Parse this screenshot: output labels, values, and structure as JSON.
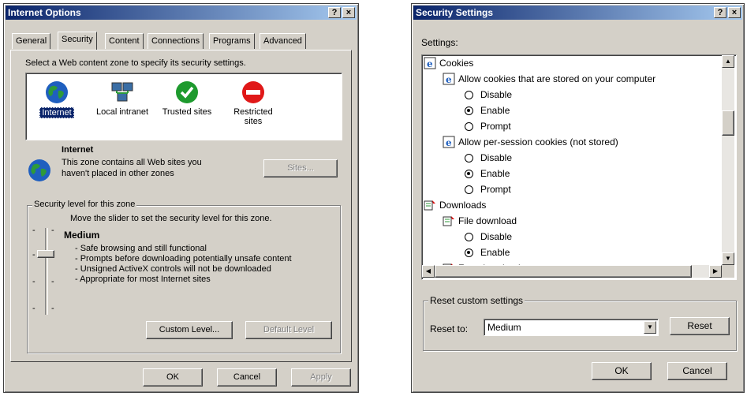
{
  "internet_options": {
    "title": "Internet Options",
    "help_label": "?",
    "close_label": "×",
    "tabs": [
      "General",
      "Security",
      "Content",
      "Connections",
      "Programs",
      "Advanced"
    ],
    "active_tab": "Security",
    "zone_prompt": "Select a Web content zone to specify its security settings.",
    "zones": [
      {
        "label": "Internet",
        "icon": "globe-icon"
      },
      {
        "label": "Local intranet",
        "icon": "intranet-icon"
      },
      {
        "label": "Trusted sites",
        "icon": "checkmark-icon"
      },
      {
        "label": "Restricted sites",
        "icon": "no-entry-icon"
      }
    ],
    "zone_title": "Internet",
    "zone_desc_1": "This zone contains all Web sites you",
    "zone_desc_2": "haven't placed in other zones",
    "sites_button": "Sites...",
    "security_group_label": "Security level for this zone",
    "slider_hint": "Move the slider to set the security level for this zone.",
    "level_name": "Medium",
    "level_bullets": [
      "- Safe browsing and still functional",
      "- Prompts before downloading potentially unsafe content",
      "- Unsigned ActiveX controls will not be downloaded",
      "- Appropriate for most Internet sites"
    ],
    "custom_level_button": "Custom Level...",
    "default_level_button": "Default Level",
    "ok_button": "OK",
    "cancel_button": "Cancel",
    "apply_button": "Apply"
  },
  "security_settings": {
    "title": "Security Settings",
    "help_label": "?",
    "close_label": "×",
    "settings_label": "Settings:",
    "tree": [
      {
        "text": "Cookies",
        "kind": "category"
      },
      {
        "text": "Allow cookies that are stored on your computer",
        "kind": "setting"
      },
      {
        "text": "Disable",
        "kind": "option",
        "selected": false
      },
      {
        "text": "Enable",
        "kind": "option",
        "selected": true
      },
      {
        "text": "Prompt",
        "kind": "option",
        "selected": false
      },
      {
        "text": "Allow per-session cookies (not stored)",
        "kind": "setting"
      },
      {
        "text": "Disable",
        "kind": "option",
        "selected": false
      },
      {
        "text": "Enable",
        "kind": "option",
        "selected": true
      },
      {
        "text": "Prompt",
        "kind": "option",
        "selected": false
      },
      {
        "text": "Downloads",
        "kind": "category"
      },
      {
        "text": "File download",
        "kind": "setting"
      },
      {
        "text": "Disable",
        "kind": "option",
        "selected": false
      },
      {
        "text": "Enable",
        "kind": "option",
        "selected": true
      },
      {
        "text": "Font download",
        "kind": "setting"
      }
    ],
    "reset_group_label": "Reset custom settings",
    "reset_to_label": "Reset to:",
    "reset_value": "Medium",
    "reset_button": "Reset",
    "ok_button": "OK",
    "cancel_button": "Cancel"
  },
  "colors": {
    "title_start": "#0a246a",
    "title_end": "#a6caf0",
    "face": "#d4d0c8",
    "selection": "#0a246a"
  }
}
